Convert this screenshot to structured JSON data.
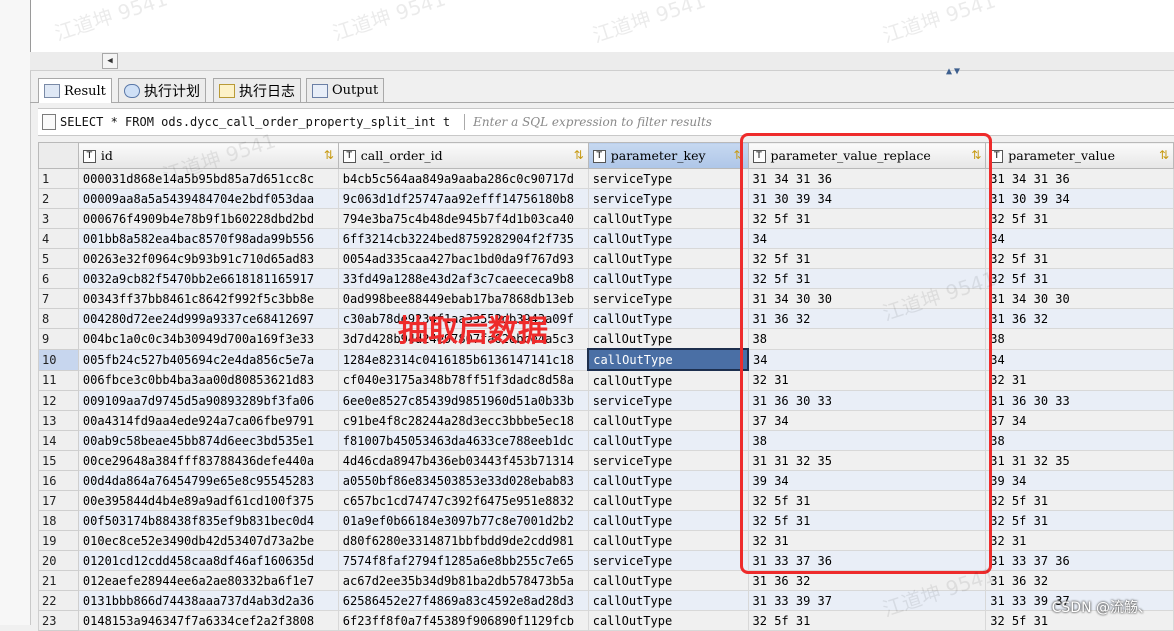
{
  "tabs": [
    {
      "label": "Result",
      "icon": "grid-icon"
    },
    {
      "label": "执行计划",
      "icon": "plan-icon"
    },
    {
      "label": "执行日志",
      "icon": "log-icon"
    },
    {
      "label": "Output",
      "icon": "output-icon"
    }
  ],
  "sql_bar": {
    "query": "SELECT * FROM ods.dycc_call_order_property_split_int t",
    "filter_placeholder": "Enter a SQL expression to filter results"
  },
  "columns": [
    "id",
    "call_order_id",
    "parameter_key",
    "parameter_value_replace",
    "parameter_value"
  ],
  "type_icon": "T",
  "rows": [
    [
      "1",
      "000031d868e14a5b95bd85a7d651cc8c",
      "b4cb5c564aa849a9aaba286c0c90717d",
      "serviceType",
      "31 34 31 36",
      "31 34 31 36"
    ],
    [
      "2",
      "00009aa8a5a5439484704e2bdf053daa",
      "9c063d1df25747aa92efff14756180b8",
      "serviceType",
      "31 30 39 34",
      "31 30 39 34"
    ],
    [
      "3",
      "000676f4909b4e78b9f1b60228dbd2bd",
      "794e3ba75c4b48de945b7f4d1b03ca40",
      "callOutType",
      "32 5f 31",
      "32 5f 31"
    ],
    [
      "4",
      "001bb8a582ea4bac8570f98ada99b556",
      "6ff3214cb3224bed8759282904f2f735",
      "callOutType",
      "34",
      "34"
    ],
    [
      "5",
      "00263e32f0964c9b93b91c710d65ad83",
      "0054ad335caa427bac1bd0da9f767d93",
      "callOutType",
      "32 5f 31",
      "32 5f 31"
    ],
    [
      "6",
      "0032a9cb82f5470bb2e6618181165917",
      "33fd49a1288e43d2af3c7caeececa9b8",
      "callOutType",
      "32 5f 31",
      "32 5f 31"
    ],
    [
      "7",
      "00343ff37bb8461c8642f992f5c3bb8e",
      "0ad998bee88449ebab17ba7868db13eb",
      "serviceType",
      "31 34 30 30",
      "31 34 30 30"
    ],
    [
      "8",
      "004280d72ee24d999a9337ce68412697",
      "c30ab78de9234f1aa33552db3943a09f",
      "callOutType",
      "31 36 32",
      "31 36 32"
    ],
    [
      "9",
      "004bc1a0c0c34b30949d700a169f3e33",
      "3d7d428b94d24e97807fa62ebce4a5c3",
      "callOutType",
      "38",
      "38"
    ],
    [
      "10",
      "005fb24c527b405694c2e4da856c5e7a",
      "1284e82314c0416185b6136147141c18",
      "callOutType",
      "34",
      "34"
    ],
    [
      "11",
      "006fbce3c0bb4ba3aa00d80853621d83",
      "cf040e3175a348b78ff51f3dadc8d58a",
      "callOutType",
      "32 31",
      "32 31"
    ],
    [
      "12",
      "009109aa7d9745d5a90893289bf3fa06",
      "6ee0e8527c85439d9851960d51a0b33b",
      "serviceType",
      "31 36 30 33",
      "31 36 30 33"
    ],
    [
      "13",
      "00a4314fd9aa4ede924a7ca06fbe9791",
      "c91be4f8c28244a28d3ecc3bbbe5ec18",
      "callOutType",
      "37 34",
      "37 34"
    ],
    [
      "14",
      "00ab9c58beae45bb874d6eec3bd535e1",
      "f81007b45053463da4633ce788eeb1dc",
      "callOutType",
      "38",
      "38"
    ],
    [
      "15",
      "00ce29648a384fff83788436defe440a",
      "4d46cda8947b436eb03443f453b71314",
      "serviceType",
      "31 31 32 35",
      "31 31 32 35"
    ],
    [
      "16",
      "00d4da864a76454799e65e8c95545283",
      "a0550bf86e834503853e33d028ebab83",
      "callOutType",
      "39 34",
      "39 34"
    ],
    [
      "17",
      "00e395844d4b4e89a9adf61cd100f375",
      "c657bc1cd74747c392f6475e951e8832",
      "callOutType",
      "32 5f 31",
      "32 5f 31"
    ],
    [
      "18",
      "00f503174b88438f835ef9b831bec0d4",
      "01a9ef0b66184e3097b77c8e7001d2b2",
      "callOutType",
      "32 5f 31",
      "32 5f 31"
    ],
    [
      "19",
      "010ec8ce52e3490db42d53407d73a2be",
      "d80f6280e3314871bbfbdd9de2cdd981",
      "callOutType",
      "32 31",
      "32 31"
    ],
    [
      "20",
      "01201cd12cdd458caa8df46af160635d",
      "7574f8faf2794f1285a6e8bb255c7e65",
      "serviceType",
      "31 33 37 36",
      "31 33 37 36"
    ],
    [
      "21",
      "012eaefe28944ee6a2ae80332ba6f1e7",
      "ac67d2ee35b34d9b81ba2db578473b5a",
      "callOutType",
      "31 36 32",
      "31 36 32"
    ],
    [
      "22",
      "0131bbb866d74438aaa737d4ab3d2a36",
      "62586452e27f4869a83c4592e8ad28d3",
      "callOutType",
      "31 33 39 37",
      "31 33 39 37"
    ],
    [
      "23",
      "0148153a946347f7a6334cef2a2f3808",
      "6f23ff8f0a7f45389f906890f1129fcb",
      "callOutType",
      "32 5f 31",
      "32 5f 31"
    ]
  ],
  "selected_row": 10,
  "annotation": "抽取后数据",
  "credit": "CSDN @流觞、",
  "watermark": "江道坤 9541",
  "colors": {
    "highlight_box": "#ee2b2b",
    "selected_cell": "#4a6fa5",
    "alt_row": "#e9eef7"
  }
}
